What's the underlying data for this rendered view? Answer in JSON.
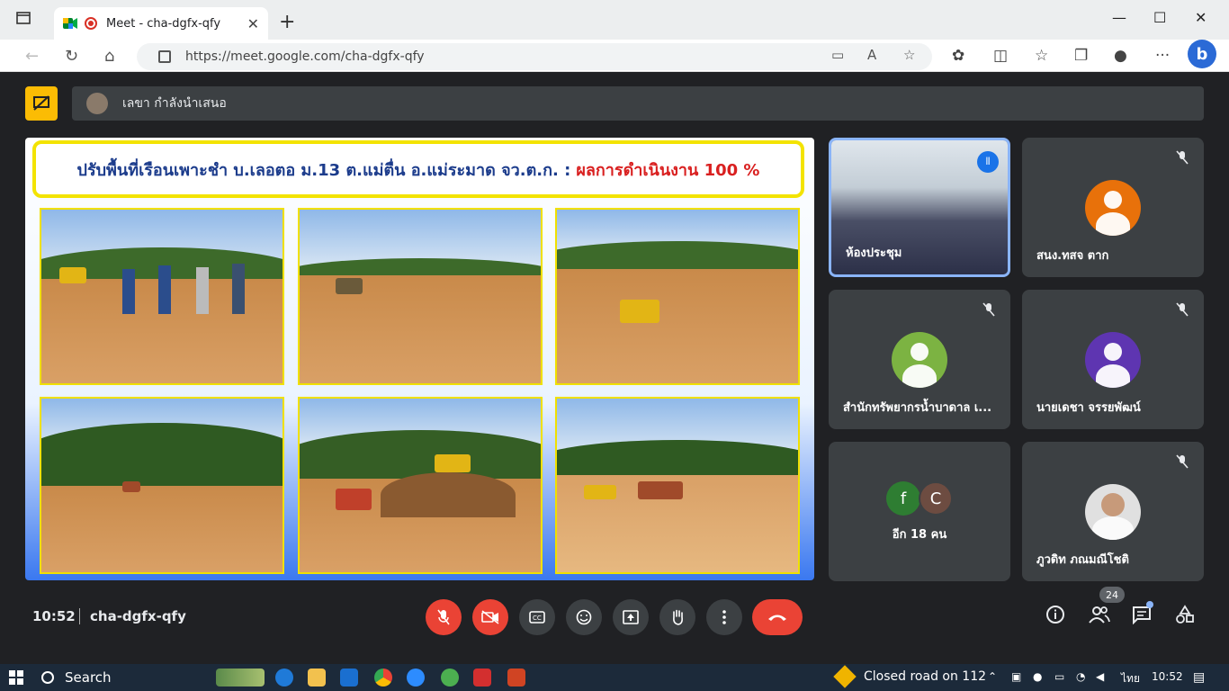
{
  "browser": {
    "tab_title": "Meet - cha-dgfx-qfy",
    "url": "https://meet.google.com/cha-dgfx-qfy"
  },
  "presentation": {
    "presenter_label": "เลขา กำลังนำเสนอ",
    "slide_title_main": "ปรับพื้นที่เรือนเพาะชำ บ.เลอตอ ม.13 ต.แม่ตื่น อ.แม่ระมาด จว.ต.ก. :",
    "slide_title_result": "ผลการดำเนินงาน 100 %"
  },
  "participants": [
    {
      "name": "ห้องประชุม",
      "muted": false,
      "speaking": true,
      "type": "video"
    },
    {
      "name": "สนง.ทสจ ตาก",
      "muted": true,
      "avatar_color": "#e8710a"
    },
    {
      "name": "สำนักทรัพยากรน้ำบาดาล เ...",
      "muted": true,
      "avatar_color": "#7cb342"
    },
    {
      "name": "นายเดชา จรรยพัฒน์",
      "muted": true,
      "avatar_color": "#5e35b1"
    },
    {
      "name": "อีก 18 คน",
      "muted": false,
      "initials": [
        "f",
        "C"
      ],
      "initial_colors": [
        "#2e7d32",
        "#6d4c41"
      ]
    },
    {
      "name": "ภูวดิท ภณมณีโชติ",
      "muted": true,
      "avatar_color": "#e0e0e0"
    }
  ],
  "controls": {
    "time": "10:52",
    "meeting_code": "cha-dgfx-qfy",
    "people_count": "24"
  },
  "taskbar": {
    "search_label": "Search",
    "notification": "Closed road on 112",
    "language": "ไทย",
    "time": "10:52"
  },
  "icons": {
    "mic_off": "mic-off-icon",
    "cam_off": "camera-off-icon",
    "captions": "captions-icon",
    "emoji": "emoji-icon",
    "present": "present-icon",
    "hand": "raise-hand-icon",
    "more": "more-icon",
    "end": "end-call-icon"
  }
}
